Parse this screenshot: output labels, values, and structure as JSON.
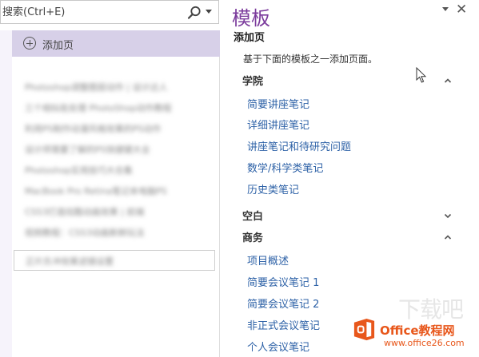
{
  "search": {
    "placeholder": "搜索(Ctrl+E)"
  },
  "page_list": {
    "add_page_label": "添加页",
    "pages": [
      "Photoshop调整图层动作 | 设计达人",
      "三个相似批处理 PhotoShop动作教程",
      "利用PS制作动漫风格效果的PS动作",
      "设计师需要了解的PS快捷键大全",
      "Photoshop实用技巧大合集",
      "MacBook Pro Retina笔记本电脑PS",
      "CSS3打造炫酷动画效果 | 前端",
      "视频教程：CSS3动画新鲜玩法",
      "正片负冲效果滤镜设置"
    ]
  },
  "templates_pane": {
    "title": "模板",
    "subtitle": "添加页",
    "description": "基于下面的模板之一添加页面。",
    "categories": [
      {
        "title": "学院",
        "expanded": true,
        "items": [
          "简要讲座笔记",
          "详细讲座笔记",
          "讲座笔记和待研究问题",
          "数学/科学类笔记",
          "历史类笔记"
        ]
      },
      {
        "title": "空白",
        "expanded": false,
        "items": []
      },
      {
        "title": "商务",
        "expanded": true,
        "items": [
          "项目概述",
          "简要会议笔记 1",
          "简要会议笔记 2",
          "非正式会议笔记",
          "个人会议笔记"
        ]
      }
    ]
  },
  "watermark": {
    "ghost_text": "下载吧",
    "brand": "Office教程网",
    "url": "www.office26.com"
  },
  "colors": {
    "accent_purple": "#7b3b9c",
    "selected_row": "#d7d0e8",
    "link_blue": "#2e62a7",
    "watermark_orange": "#e8571b"
  }
}
